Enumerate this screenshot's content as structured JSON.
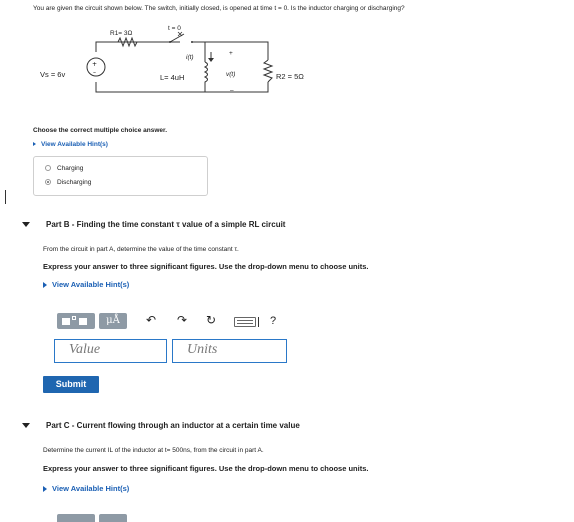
{
  "question": "You are given the circuit shown below. The switch, initially closed, is opened at time t = 0. Is the inductor charging or discharging?",
  "circuit": {
    "source_label": "Vs = 6v",
    "r1_label": "R1= 3Ω",
    "switch_label": "t = 0",
    "current_label": "i(t)",
    "inductor_label": "L= 4uH",
    "voltage_label": "v(t)",
    "r2_label": "R2 = 5Ω",
    "plus": "+",
    "minus": "–"
  },
  "part_a": {
    "prompt": "Choose the correct multiple choice answer.",
    "hint_label": "View Available Hint(s)",
    "options": [
      {
        "label": "Charging",
        "selected": false
      },
      {
        "label": "Discharging",
        "selected": true
      }
    ]
  },
  "part_b": {
    "title": "Part B - Finding the time constant τ value of a simple RL circuit",
    "instruction": "From the circuit in part A, determine the value of the time constant τ.",
    "format_note": "Express your answer to three significant figures. Use the drop-down menu to choose units.",
    "hint_label": "View Available Hint(s)",
    "value_placeholder": "Value",
    "units_placeholder": "Units",
    "toolbar": {
      "mu_label": "μÅ",
      "help": "?"
    },
    "submit_label": "Submit"
  },
  "part_c": {
    "title": "Part C - Current flowing through an inductor at a certain time value",
    "instruction": "Determine the current IL of the inductor at t= 500ns, from the circuit in part A.",
    "format_note": "Express your answer to three significant figures. Use the drop-down menu to choose units.",
    "hint_label": "View Available Hint(s)"
  }
}
